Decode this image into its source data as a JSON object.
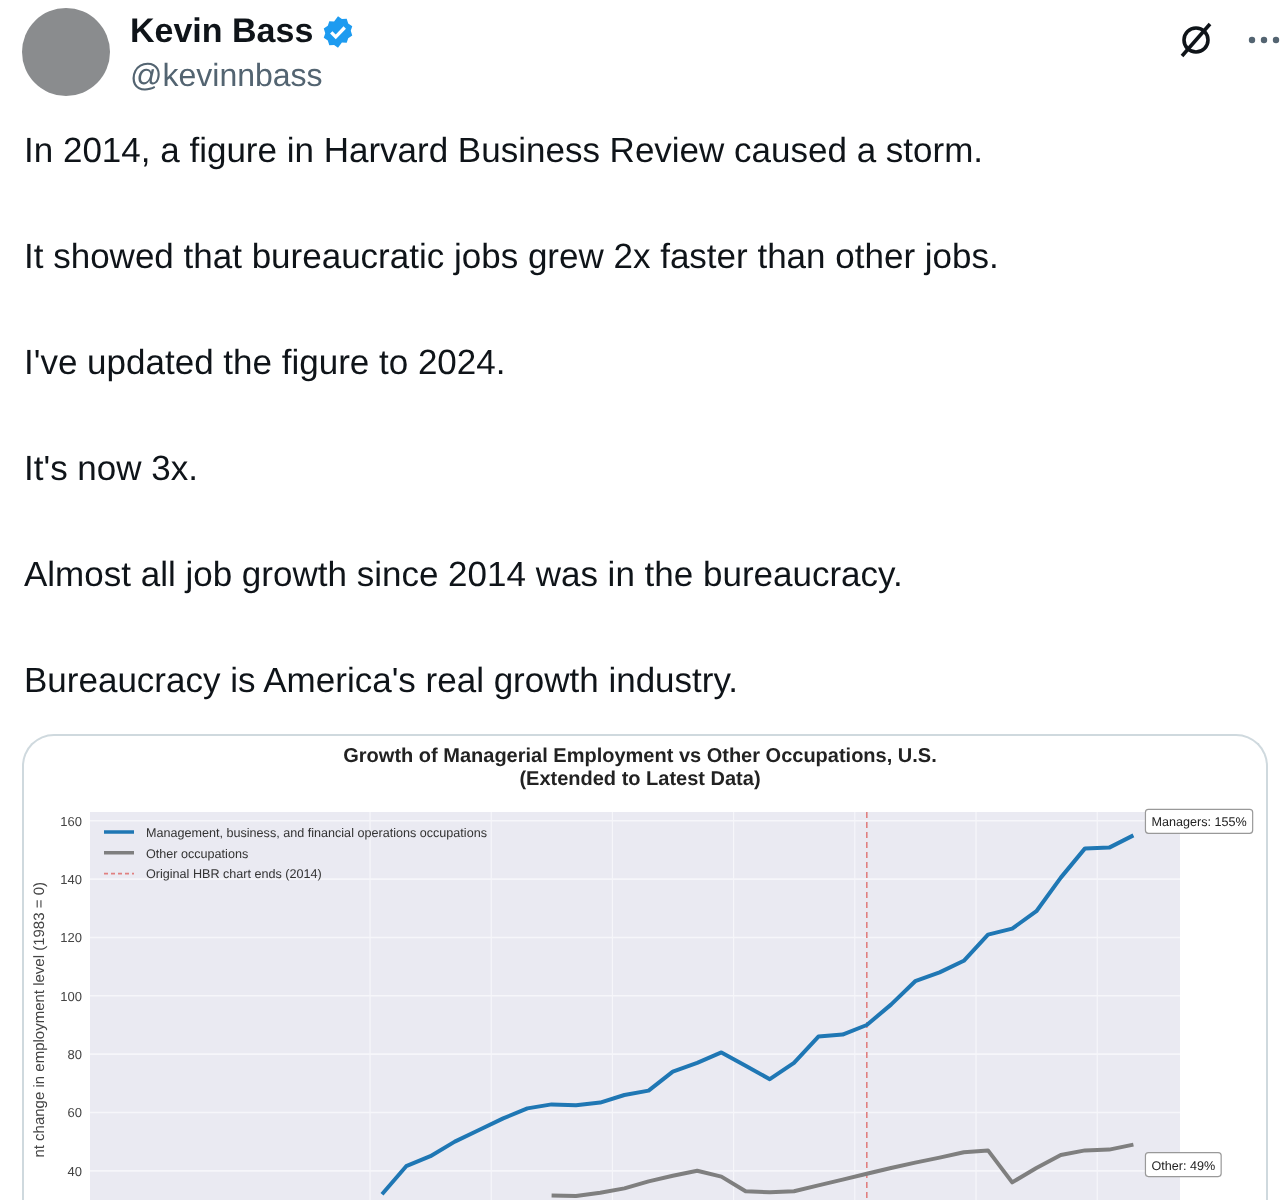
{
  "tweet": {
    "author": {
      "name": "Kevin Bass",
      "handle": "@kevinnbass",
      "verified": true
    },
    "paragraphs": [
      "In 2014, a figure in Harvard Business Review caused a storm.",
      "It showed that bureaucratic jobs grew 2x faster than other jobs.",
      "I've updated the figure to 2024.",
      "It's now 3x.",
      "Almost all job growth since 2014 was in the bureaucracy.",
      "Bureaucracy is America's real growth industry."
    ],
    "media": {
      "chart_data": {
        "type": "line",
        "title": "Growth of Managerial Employment vs Other Occupations, U.S.\n(Extended to Latest Data)",
        "ylabel": "nt change in employment level (1983 = 0)",
        "grid": true,
        "legend": "upper left",
        "ylim": [
          30,
          163
        ],
        "yticks": [
          40,
          60,
          80,
          100,
          120,
          140,
          160
        ],
        "series": [
          {
            "name": "Management, business, and financial operations occupations",
            "color": "#1f77b4",
            "values": [
              32,
              41.6,
              45,
              50,
              54,
              58,
              61.4,
              62.8,
              62.5,
              63.4,
              66,
              67.5,
              74,
              77,
              80.6,
              76,
              71.4,
              77,
              86,
              86.7,
              90,
              97,
              105,
              108,
              112,
              121,
              123,
              129,
              140.5,
              150.5,
              150.8,
              155
            ]
          },
          {
            "name": "Other occupations",
            "color": "#7f7f7f",
            "values": [
              null,
              null,
              null,
              null,
              null,
              null,
              null,
              31.5,
              31.4,
              32.5,
              34,
              36.4,
              38.3,
              40,
              38,
              33,
              32.7,
              33,
              35,
              37,
              39,
              41,
              42.8,
              44.5,
              46.4,
              47,
              36,
              41,
              45.4,
              47,
              47.3,
              49
            ]
          }
        ],
        "ref_lines": [
          {
            "label": "Original HBR chart ends (2014)",
            "color": "#e08080"
          }
        ],
        "annotations": [
          {
            "text": "Managers: 155%"
          },
          {
            "text": "Other: 49%"
          }
        ]
      }
    }
  }
}
